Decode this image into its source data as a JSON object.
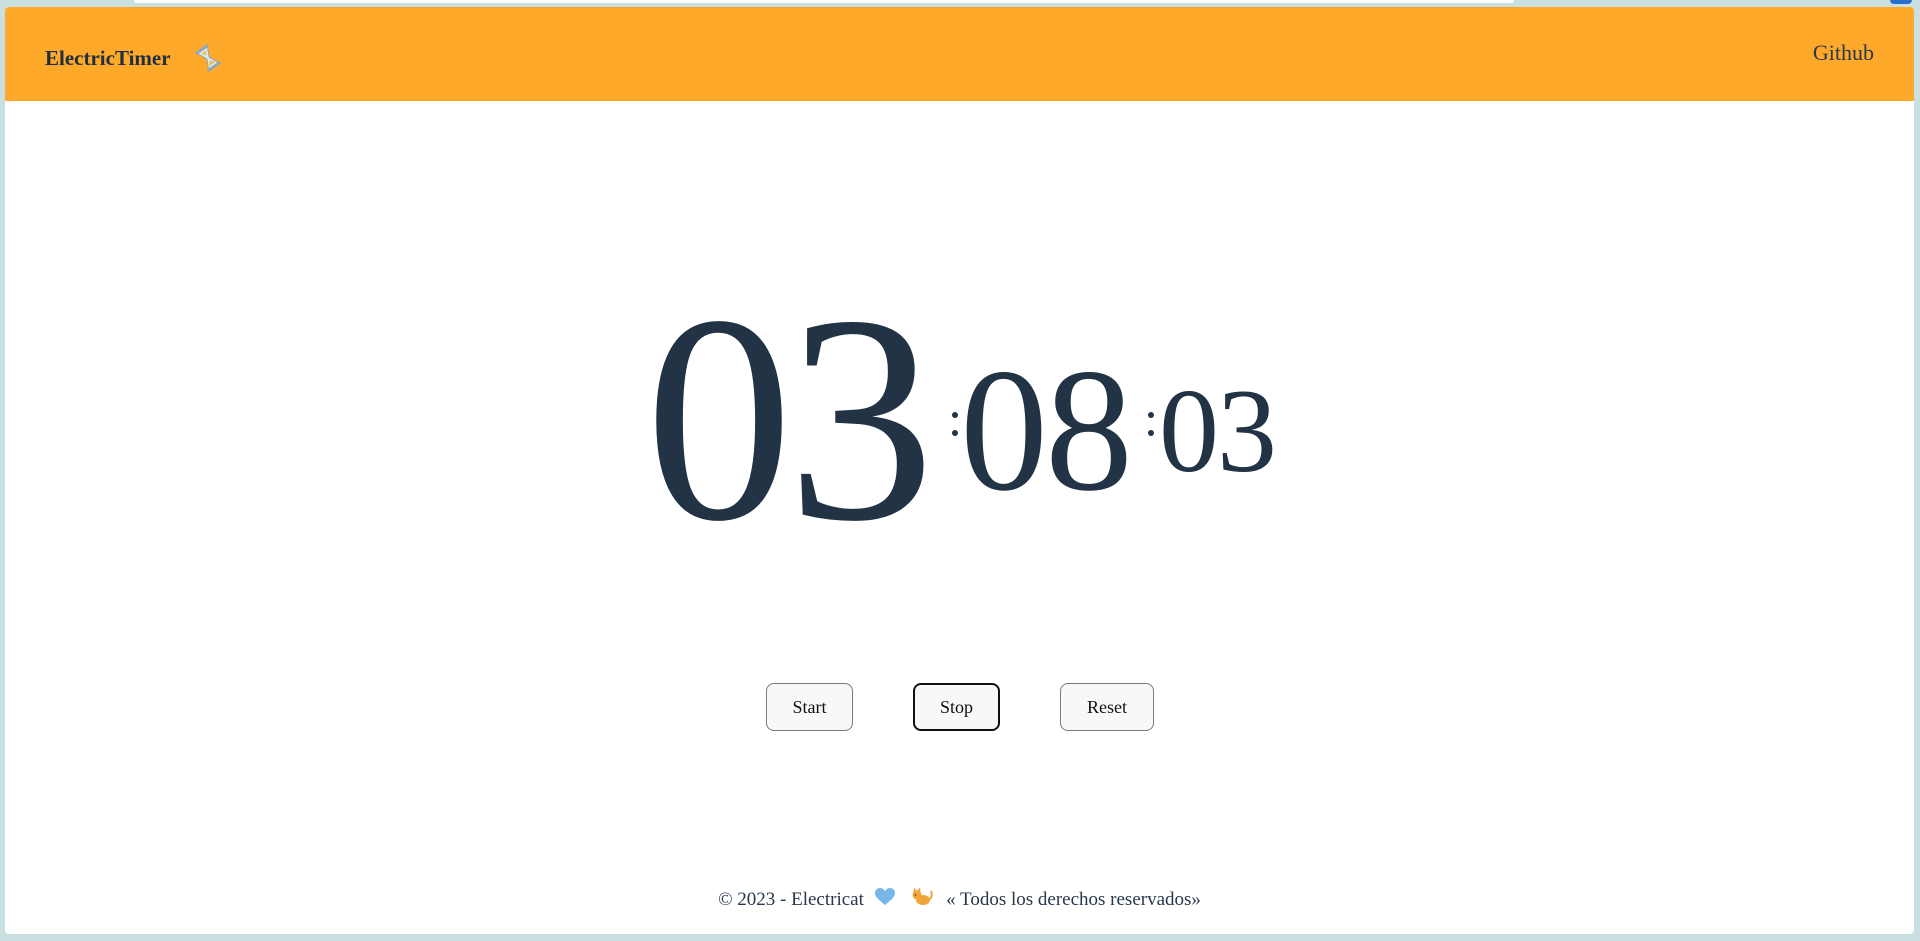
{
  "header": {
    "brand": "ElectricTimer",
    "brand_icon": "hourglass-icon",
    "github_label": "Github"
  },
  "timer": {
    "hours": "03",
    "minutes": "08",
    "seconds": "03"
  },
  "controls": {
    "start_label": "Start",
    "stop_label": "Stop",
    "reset_label": "Reset"
  },
  "footer": {
    "copyright": "© 2023 - Electricat",
    "heart_icon": "blue-heart-icon",
    "cat_icon": "cat-icon",
    "rights": "« Todos los derechos reservados»"
  },
  "colors": {
    "navbar": "#ffa92b",
    "digits": "#213345",
    "text": "#26384a"
  }
}
